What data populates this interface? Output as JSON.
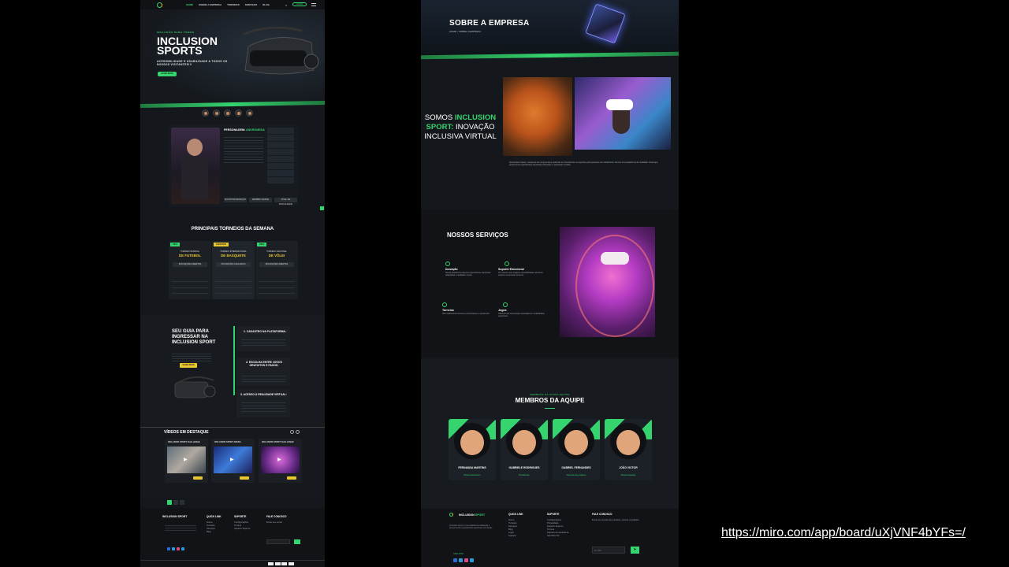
{
  "left": {
    "nav": {
      "links": [
        "HOME",
        "SOBRE A EMPRESA",
        "TORNEIOS",
        "SERVIÇOS",
        "BLOG"
      ],
      "login": "LOGIN"
    },
    "hero": {
      "kicker": "INCLUSÃO PARA TODOS",
      "title": "INCLUSION SPORTS",
      "subtitle": "ACESSIBILIDADE E USABILIDADE A TODOS OS NOSSOS VISITANTES!!!",
      "cta": "SAIBA MAIS"
    },
    "character": {
      "label": "PERSONAGEM:",
      "name": "ANDROMEDA",
      "buttons": [
        "MAIOR INFORMAÇÃO",
        "MEMBRO DESDE",
        "NÍVEL DE DIFICULDADE"
      ]
    },
    "tournaments": {
      "title": "PRINCIPAIS TORNEIOS DA SEMANA",
      "cards": [
        {
          "tag": "PIKG",
          "pre": "TORNEIO MUNDIAL",
          "sport": "DE FUTEBOL",
          "status": "INSCRIÇÕES ABERTAS"
        },
        {
          "tag": "SHOOTER",
          "pre": "TORNEIO INTERNACIONAL",
          "sport": "DE BASQUETE",
          "status": "INSCRIÇÕES FECHADAS"
        },
        {
          "tag": "PIKG",
          "pre": "TORNEIO NACIONAL",
          "sport": "DE VÔLEI",
          "status": "INSCRIÇÕES ABERTAS"
        }
      ]
    },
    "guide": {
      "title": "SEU GUIA PARA INGRESSAR NA INCLUSION SPORT",
      "cta": "SAIBA MAIS",
      "steps": [
        "1. CADASTRO NA PLATAFORMA:",
        "2. ESCOLHA ENTRE JOGOS GRATUITOS E PAGOS:",
        "3. ACESSO À REALIDADE VIRTUAL:"
      ]
    },
    "videos": {
      "title": "VÍDEOS EM DESTAQUE",
      "items": [
        "INCLUSION SPORT CHALLENGE",
        "INCLUSION SPORT ARENA",
        "INCLUSION SPORT CHALLENGE"
      ]
    },
    "footer": {
      "brand": "INCLUSION SPORT",
      "cols": [
        {
          "title": "QUICK LINK",
          "items": [
            "Home",
            "Torneios",
            "Serviços",
            "Blog",
            "Login"
          ]
        },
        {
          "title": "SUPORTE",
          "items": [
            "Configurações",
            "Termos",
            "Ajuda & Suporte",
            "Suporte"
          ]
        },
        {
          "title": "FALE CONOSCO",
          "items": [
            "Envie seu email"
          ]
        }
      ]
    }
  },
  "right": {
    "hero": {
      "title": "SOBRE A EMPRESA",
      "crumb": "HOME • SOBRE A EMPRESA"
    },
    "about": {
      "heading_pre": "SOMOS ",
      "heading_green": "INCLUSION SPORT:",
      "heading_post": " INOVAÇÃO INCLUSIVA VIRTUAL",
      "text": "Na Inclusion Sport, nascemos do compromisso profundo em transformar os esportes para pessoas com deficiência. Somos uma plataforma de realidade virtual que proporciona experiências esportivas inclusivas e acessíveis a todos."
    },
    "services": {
      "title": "NOSSOS SERVIÇOS",
      "items": [
        {
          "name": "Inovação",
          "text": "Nossa plataforma oferece experiências esportivas adaptadas à realidade virtual."
        },
        {
          "name": "Suporte Emocional",
          "text": "Os nossos com equipes especializadas oferecem suporte emocional contínuo."
        },
        {
          "name": "Torneios",
          "text": "Nós realizamos torneios emocionantes e acessíveis."
        },
        {
          "name": "Jogos",
          "text": "Oferecemos uma ampla variedade de modalidades esportivas."
        }
      ]
    },
    "team": {
      "kicker": "MEMBROS DA NOSSA EQUIPE",
      "title": "MEMBROS DA AQUIPE",
      "members": [
        {
          "name": "FERNANDA MARTINS",
          "role": "Diretor Executivo"
        },
        {
          "name": "GABRIELE RODRIGUES",
          "role": "Presidente"
        },
        {
          "name": "GABRIEL FERNANDES",
          "role": "Gerente de projetos"
        },
        {
          "name": "JOÃO VICTOR",
          "role": "Desenvolvedor"
        }
      ]
    },
    "footer": {
      "brand_a": "INCLUSION ",
      "brand_b": "SPORT",
      "about": "Inclusion sport é uma plataforma dedicada a proporcionar experiências esportivas inclusivas.",
      "follow": "SIGA-NOS",
      "cols": [
        {
          "title": "QUICK LINK",
          "items": [
            "Home",
            "Torneios",
            "Serviços",
            "Blog",
            "Login",
            "Suporte"
          ]
        },
        {
          "title": "SUPORTE",
          "items": [
            "Configurações",
            "Privacidade",
            "Ajuda & Suporte",
            "Termos",
            "Suporte de assinatura",
            "Atendimento",
            "Termos e condições"
          ]
        },
        {
          "title": "FALE CONOSCO",
          "items": [
            "Envie seu email para receber nossas novidades"
          ]
        }
      ],
      "email_placeholder": "E-mail"
    }
  },
  "link": "https://miro.com/app/board/uXjVNF4bYFs=/",
  "colors": {
    "accent": "#35d46f",
    "yellow": "#e8c630",
    "panel": "#14171b",
    "bg": "#000000"
  }
}
